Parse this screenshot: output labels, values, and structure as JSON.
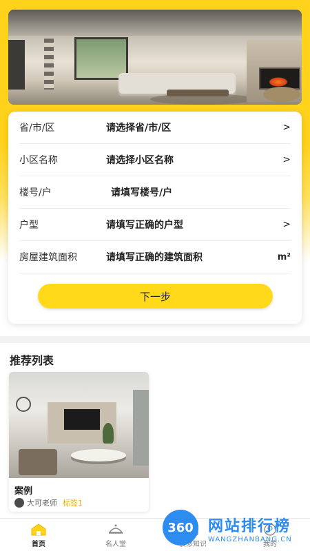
{
  "form": {
    "rows": [
      {
        "label": "省/市/区",
        "value": "请选择省/市/区",
        "suffix": ">"
      },
      {
        "label": "小区名称",
        "value": "请选择小区名称",
        "suffix": ">"
      },
      {
        "label": "楼号/户",
        "value": "请填写楼号/户",
        "suffix": ""
      },
      {
        "label": "户型",
        "value": "请填写正确的户型",
        "suffix": ">"
      },
      {
        "label": "房屋建筑面积",
        "value": "请填写正确的建筑面积",
        "suffix": "m²"
      }
    ],
    "next_label": "下一步"
  },
  "recommend": {
    "title": "推荐列表",
    "items": [
      {
        "title": "案例",
        "author": "大可老师",
        "tag": "标签1"
      }
    ]
  },
  "tabbar": {
    "items": [
      {
        "label": "首页",
        "icon": "home-icon",
        "active": true
      },
      {
        "label": "名人堂",
        "icon": "hall-of-fame-icon",
        "active": false
      },
      {
        "label": "装修知识",
        "icon": "knowledge-icon",
        "active": false
      },
      {
        "label": "我的",
        "icon": "profile-icon",
        "active": false
      }
    ]
  },
  "watermark": {
    "badge": "360",
    "text": "网站排行榜",
    "sub": "WANGZHANBANG.CN"
  },
  "colors": {
    "accent": "#ffd91a",
    "tag": "#e9b400",
    "watermark": "#2d8cf0"
  }
}
